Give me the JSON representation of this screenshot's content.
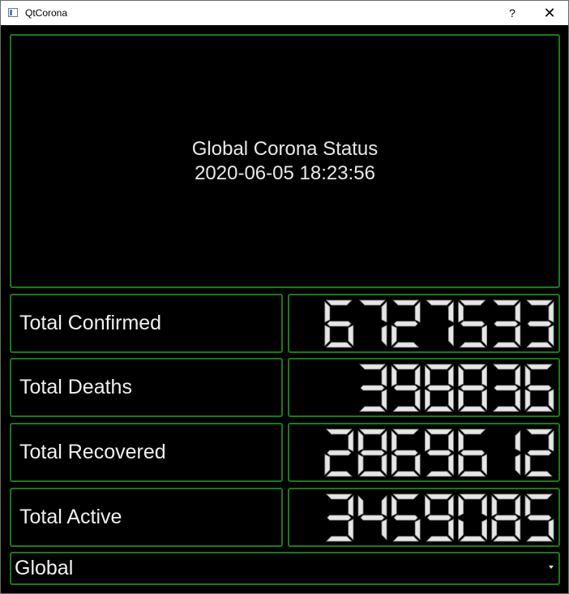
{
  "window": {
    "title": "QtCorona",
    "help_label": "?",
    "close_label": "✕"
  },
  "status": {
    "title": "Global Corona Status",
    "timestamp": "2020-06-05 18:23:56"
  },
  "stats": [
    {
      "label": "Total Confirmed",
      "value": "6727533"
    },
    {
      "label": "Total Deaths",
      "value": "398836"
    },
    {
      "label": "Total Recovered",
      "value": "2869612"
    },
    {
      "label": "Total Active",
      "value": "3459085"
    }
  ],
  "region_select": {
    "selected": "Global"
  },
  "colors": {
    "border": "#1a7a1a",
    "background": "#000000",
    "text": "#f0f0f0",
    "lcd_face": "#e6e6e6"
  }
}
